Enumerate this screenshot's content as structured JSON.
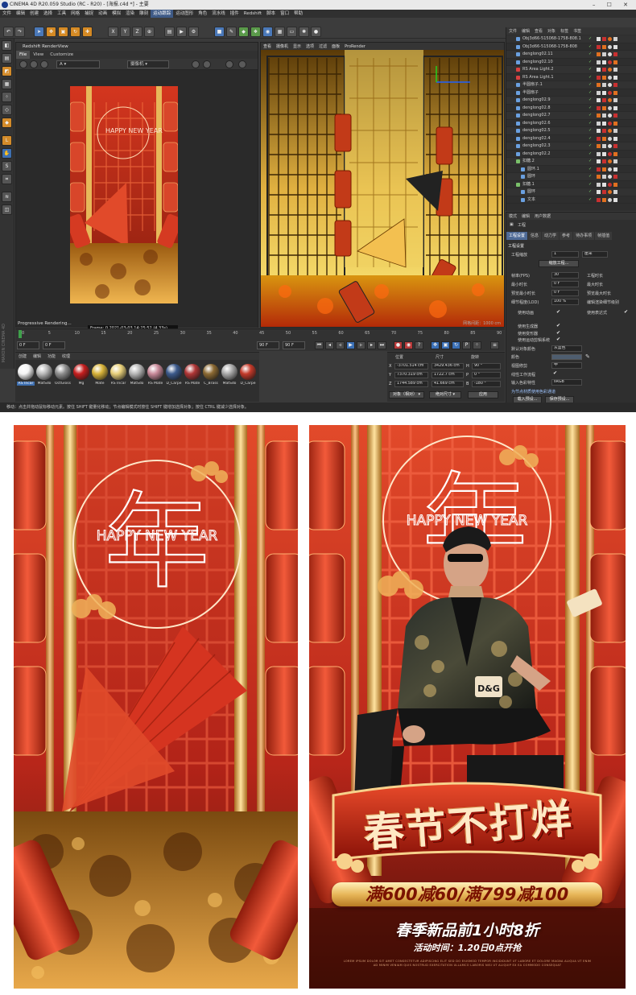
{
  "window": {
    "title": "CINEMA 4D R20.059 Studio (RC - R20) - [海报.c4d *] - 主要",
    "controls": "– ☐ ✕"
  },
  "menubar": [
    "文件",
    "编辑",
    "创建",
    "选择",
    "工具",
    "网格",
    "捕捉",
    "动画",
    "模拟",
    "渲染",
    "雕刻",
    "运动跟踪",
    "运动图形",
    "角色",
    "流水线",
    "插件",
    "Redshift",
    "脚本",
    "窗口",
    "帮助"
  ],
  "menubar_active": "运动跟踪",
  "toolbar": {
    "axis_buttons": [
      "X",
      "Y",
      "Z"
    ],
    "undo_icon": "undo-icon",
    "redo_icon": "redo-icon",
    "select_icon": "select-arrow-icon",
    "move_icon": "move-icon",
    "scale_icon": "scale-icon",
    "rotate_icon": "rotate-icon",
    "render_icon": "render-icon",
    "cube_icon": "cube-icon",
    "pen_icon": "pen-icon",
    "light_icon": "light-icon",
    "camera_icon": "camera-icon"
  },
  "render_view": {
    "title": "Redshift RenderView",
    "menu": [
      "File",
      "View",
      "Customize"
    ],
    "camera_select": "摄像机",
    "stamp": "Frame: 0  2021-03-03 14:25:52 (4.33s)",
    "status": "Progressive Rendering..."
  },
  "viewport": {
    "menu": [
      "查看",
      "摄像机",
      "显示",
      "选项",
      "过滤",
      "面板",
      "ProRender"
    ],
    "footer": "网格间距：1000 cm"
  },
  "timeline": {
    "ticks": [
      "0",
      "5",
      "10",
      "15",
      "20",
      "25",
      "30",
      "35",
      "40",
      "45",
      "50",
      "55",
      "60",
      "65",
      "70",
      "75",
      "80",
      "85",
      "90"
    ],
    "field_start": "0 F",
    "field_current": "0 F",
    "field_end": "90 F",
    "field_max": "90 F",
    "frame_right": "0 F"
  },
  "material_manager": {
    "tabs": [
      "创建",
      "编辑",
      "功能",
      "纹理"
    ],
    "materials": [
      {
        "label": "RS Incar",
        "color": "#f5f5f5",
        "selected": true
      },
      {
        "label": "MatSdo",
        "color": "#b9b9b9"
      },
      {
        "label": "OctGloss",
        "color": "#8f8f8f"
      },
      {
        "label": "Mg",
        "color": "#c61e1e"
      },
      {
        "label": "Mate",
        "color": "#d9b43a"
      },
      {
        "label": "RS Incar",
        "color": "#e8d07a"
      },
      {
        "label": "MatSdo",
        "color": "#b7b7b7"
      },
      {
        "label": "RS Mate",
        "color": "#c98a9a"
      },
      {
        "label": "D_Carpe",
        "color": "#3c5a8c"
      },
      {
        "label": "RS Mate",
        "color": "#b03636"
      },
      {
        "label": "C_Brass",
        "color": "#8c6a33"
      },
      {
        "label": "MatSdo",
        "color": "#aaaaaa"
      },
      {
        "label": "D_Carpe",
        "color": "#c43a2a"
      }
    ]
  },
  "coordinates": {
    "headers": [
      "位置",
      "尺寸",
      "旋转"
    ],
    "rows": [
      {
        "axis": "X",
        "pos": "-3701.514 cm",
        "size": "3429.436 cm",
        "rot_label": "H",
        "rot": "90 °"
      },
      {
        "axis": "Y",
        "pos": "7370.319 cm",
        "size": "1722.7 cm",
        "rot_label": "P",
        "rot": "0 °"
      },
      {
        "axis": "Z",
        "pos": "1744.589 cm",
        "size": "41.669 cm",
        "rot_label": "B",
        "rot": "-180 °"
      }
    ],
    "mode_object": "对象（相对）",
    "mode_size": "绝对尺寸",
    "apply_button": "应用"
  },
  "object_manager": {
    "menu": [
      "文件",
      "编辑",
      "查看",
      "对象",
      "标签",
      "书签"
    ],
    "rows": [
      {
        "name": "Obj3d66-515068-1758-808.1",
        "indent": 0,
        "icon": "#6aa0e0"
      },
      {
        "name": "Obj3d66-515068-1758-808",
        "indent": 0,
        "icon": "#6aa0e0"
      },
      {
        "name": "denglong02.11",
        "indent": 0,
        "icon": "#6aa0e0"
      },
      {
        "name": "denglong02.10",
        "indent": 0,
        "icon": "#6aa0e0"
      },
      {
        "name": "RS Area Light.2",
        "indent": 0,
        "icon": "#d84040"
      },
      {
        "name": "RS Area Light.1",
        "indent": 0,
        "icon": "#d84040"
      },
      {
        "name": "半圆扇子.1",
        "indent": 0,
        "icon": "#6aa0e0"
      },
      {
        "name": "半圆扇子",
        "indent": 0,
        "icon": "#6aa0e0"
      },
      {
        "name": "denglong02.9",
        "indent": 0,
        "icon": "#6aa0e0"
      },
      {
        "name": "denglong02.8",
        "indent": 0,
        "icon": "#6aa0e0"
      },
      {
        "name": "denglong02.7",
        "indent": 0,
        "icon": "#6aa0e0"
      },
      {
        "name": "denglong02.6",
        "indent": 0,
        "icon": "#6aa0e0"
      },
      {
        "name": "denglong02.5",
        "indent": 0,
        "icon": "#6aa0e0"
      },
      {
        "name": "denglong02.4",
        "indent": 0,
        "icon": "#6aa0e0"
      },
      {
        "name": "denglong02.3",
        "indent": 0,
        "icon": "#6aa0e0"
      },
      {
        "name": "denglong02.2",
        "indent": 0,
        "icon": "#6aa0e0"
      },
      {
        "name": "扣糖.2",
        "indent": 0,
        "icon": "#7ac06a"
      },
      {
        "name": "圆环.1",
        "indent": 1,
        "icon": "#6aa0e0"
      },
      {
        "name": "圆环",
        "indent": 1,
        "icon": "#6aa0e0"
      },
      {
        "name": "扣糖.1",
        "indent": 0,
        "icon": "#7ac06a"
      },
      {
        "name": "圆环",
        "indent": 1,
        "icon": "#6aa0e0"
      },
      {
        "name": "文本",
        "indent": 1,
        "icon": "#6aa0e0"
      }
    ]
  },
  "attribute_manager": {
    "menu": [
      "模式",
      "编辑",
      "用户数据"
    ],
    "header": "工程",
    "tabs": [
      "工程设置",
      "信息",
      "动力学",
      "参考",
      "待办事项",
      "帧插值"
    ],
    "section": "工程设置",
    "project_scale_label": "工程缩放",
    "project_scale_value": "1",
    "project_scale_unit": "厘米",
    "scale_button": "缩放工程...",
    "fps_label": "帧率(FPS)",
    "fps_value": "30",
    "min_time_label": "最小时长",
    "min_time_value": "0 F",
    "preview_min_label": "预览最小时长",
    "preview_min_value": "0 F",
    "lod_label": "细节程度(LOD)",
    "lod_value": "100 %",
    "right_labels": [
      "工程时长",
      "最大时长",
      "预览最大时长",
      "编辑渲染细节级别"
    ],
    "checks": [
      "使用动画",
      "使用表达式",
      "使用生成器",
      "使用变形器",
      "使用运动剪辑系统"
    ],
    "default_color_label": "默认对象颜色",
    "default_color_value": "灰蓝色",
    "color_label": "颜色",
    "view_clip_label": "视图修剪",
    "view_clip_value": "中",
    "linear_label": "线性工作流程",
    "input_color_label": "输入色彩特性",
    "input_color_value": "sRGB",
    "node_label": "为节点材质使用色彩通道",
    "load_button": "载入预设...",
    "save_button": "保存预设..."
  },
  "statusbar": "移动：点击并拖动鼠标移动元素。按住 SHIFT 键量化移动；节点编辑模式时按住 SHIFT 键增加选择对象；按住 CTRL 键减少选择对象。",
  "poster_a": {
    "happy_new_year": "HAPPY NEW YEAR",
    "glyph": "年"
  },
  "poster_b": {
    "happy_new_year": "HAPPY NEW YEAR",
    "glyph": "年",
    "jacket_logo": "D&G",
    "title": "春节不打烊",
    "offer": "满600减60/满799减100",
    "promo": "春季新品前1小时8折",
    "time": "活动时间：1.20日0点开抢",
    "fineprint": "LOREM IPSUM DOLOR SIT AMET CONSECTETUR ADIPISCING ELIT SED DO EIUSMOD TEMPOR INCIDIDUNT UT LABORE ET DOLORE MAGNA ALIQUA UT ENIM AD MINIM VENIAM QUIS NOSTRUD EXERCITATION ULLAMCO LABORIS NISI UT ALIQUIP EX EA COMMODO CONSEQUAT"
  },
  "colors": {
    "c4d_bg": "#3a3a3a",
    "accent_blue": "#3e6fb0",
    "poster_red": "#c62a1e",
    "poster_gold": "#e8b75a"
  }
}
